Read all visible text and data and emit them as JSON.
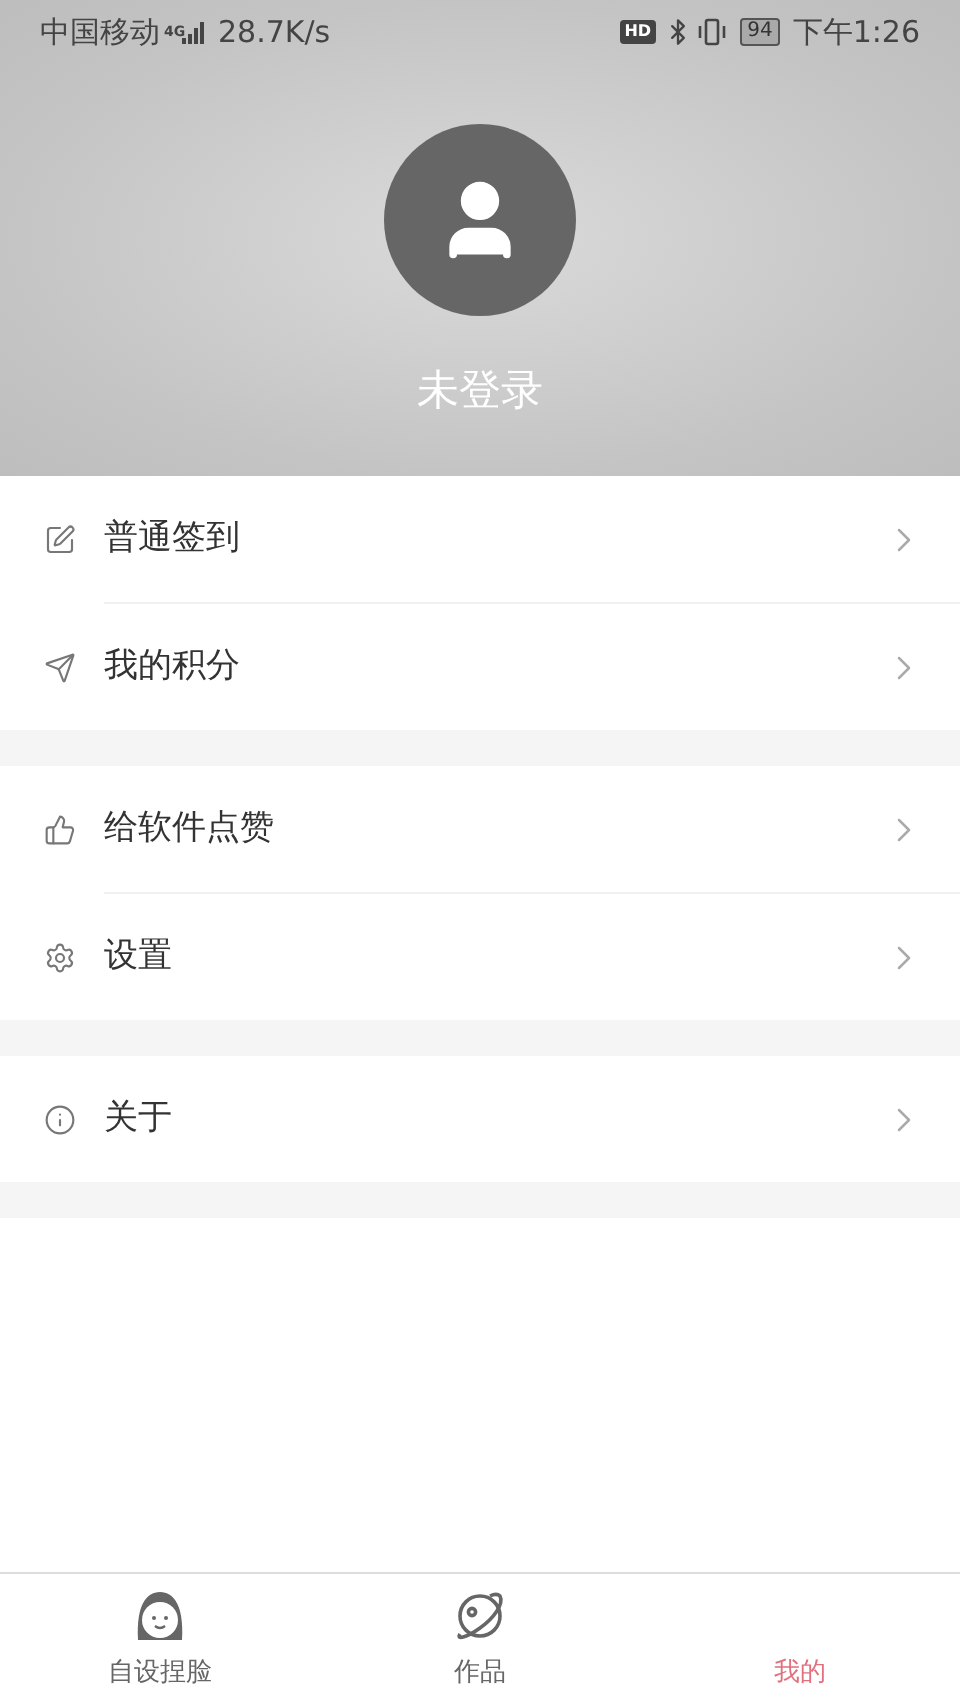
{
  "status_bar": {
    "carrier": "中国移动",
    "network": "4G",
    "hd": "HD",
    "speed": "28.7K/s",
    "battery": "94",
    "time": "下午1:26"
  },
  "profile": {
    "name": "未登录"
  },
  "groups": [
    {
      "items": [
        {
          "kind": "checkin",
          "label": "普通签到"
        },
        {
          "kind": "points",
          "label": "我的积分"
        }
      ]
    },
    {
      "items": [
        {
          "kind": "like",
          "label": "给软件点赞"
        },
        {
          "kind": "settings",
          "label": "设置"
        }
      ]
    },
    {
      "items": [
        {
          "kind": "about",
          "label": "关于"
        }
      ]
    }
  ],
  "tabs": [
    {
      "kind": "face",
      "label": "自设捏脸",
      "selected": false
    },
    {
      "kind": "works",
      "label": "作品",
      "selected": false
    },
    {
      "kind": "mine",
      "label": "我的",
      "selected": true
    }
  ]
}
